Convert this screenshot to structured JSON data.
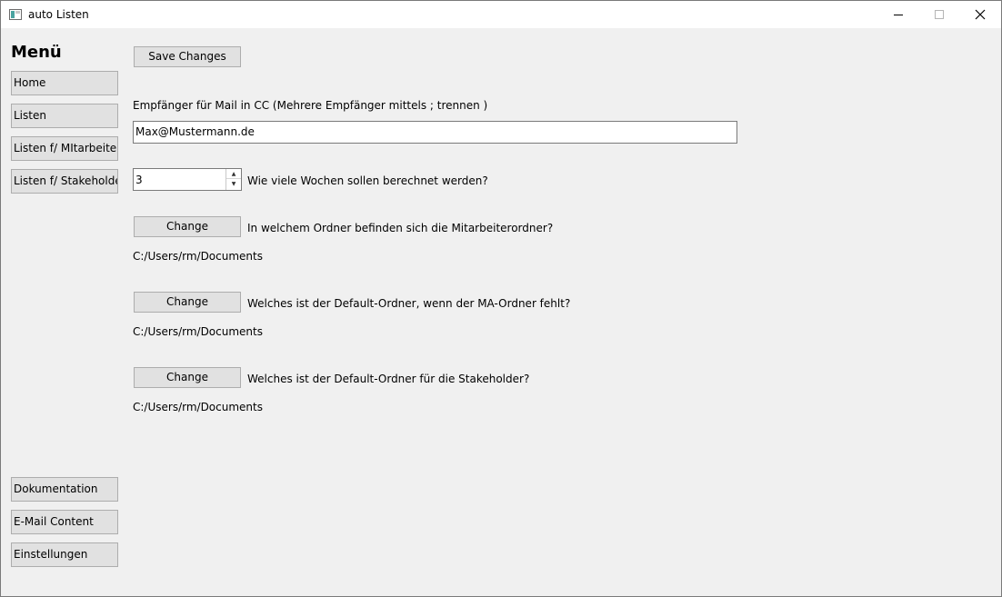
{
  "window": {
    "title": "auto Listen"
  },
  "sidebar": {
    "title": "Menü",
    "top_items": [
      {
        "label": "Home"
      },
      {
        "label": "Listen"
      },
      {
        "label": "Listen f/ MItarbeiter"
      },
      {
        "label": "Listen f/ Stakeholder"
      }
    ],
    "bottom_items": [
      {
        "label": "Dokumentation"
      },
      {
        "label": "E-Mail Content"
      },
      {
        "label": "Einstellungen"
      }
    ]
  },
  "main": {
    "save_label": "Save Changes",
    "cc_label": "Empfänger für Mail in CC (Mehrere Empfänger mittels ; trennen )",
    "cc_value": "Max@Mustermann.de",
    "weeks_value": "3",
    "weeks_label": "Wie viele Wochen sollen berechnet werden?",
    "folders": [
      {
        "button": "Change",
        "question": "In welchem Ordner befinden sich die Mitarbeiterordner?",
        "path": "C:/Users/rm/Documents"
      },
      {
        "button": "Change",
        "question": "Welches ist der Default-Ordner, wenn der MA-Ordner fehlt?",
        "path": "C:/Users/rm/Documents"
      },
      {
        "button": "Change",
        "question": "Welches ist der Default-Ordner für die Stakeholder?",
        "path": "C:/Users/rm/Documents"
      }
    ]
  }
}
